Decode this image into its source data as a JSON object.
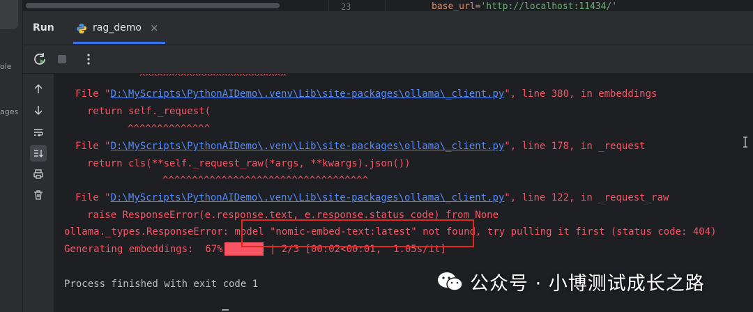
{
  "left_strip": {
    "labels": [
      "ole",
      "ages"
    ]
  },
  "editor_peek": {
    "line_number": "23",
    "code_key": "base_url=",
    "code_value": "'http://localhost:11434/'"
  },
  "header": {
    "title": "Run",
    "tab": {
      "label": "rag_demo",
      "close": "×"
    }
  },
  "toolbar": {
    "icons": [
      "rerun-icon",
      "stop-icon",
      "more-icon"
    ]
  },
  "side_actions": [
    "up-arrow-icon",
    "down-arrow-icon",
    "soft-wrap-icon",
    "scroll-to-end-icon",
    "print-icon",
    "trash-icon"
  ],
  "console": {
    "lines": [
      {
        "kind": "caret",
        "text": "^^^^^^^^^^^^^^^^^^^^^^^^^"
      },
      {
        "kind": "file",
        "prefix": "File \"",
        "path": "D:\\MyScripts\\PythonAIDemo\\.venv\\Lib\\site-packages\\ollama\\_client.py",
        "suffix": "\", line 380, in embeddings"
      },
      {
        "kind": "code",
        "text": "return self._request("
      },
      {
        "kind": "caret",
        "text": "^^^^^^^^^^^^^^"
      },
      {
        "kind": "file",
        "prefix": "File \"",
        "path": "D:\\MyScripts\\PythonAIDemo\\.venv\\Lib\\site-packages\\ollama\\_client.py",
        "suffix": "\", line 178, in _request"
      },
      {
        "kind": "code",
        "text": "return cls(**self._request_raw(*args, **kwargs).json())"
      },
      {
        "kind": "caret",
        "text": "^^^^^^^^^^^^^^^^^^^^^^^^^^^^^^^^^^^"
      },
      {
        "kind": "file",
        "prefix": "File \"",
        "path": "D:\\MyScripts\\PythonAIDemo\\.venv\\Lib\\site-packages\\ollama\\_client.py",
        "suffix": "\", line 122, in _request_raw"
      },
      {
        "kind": "code",
        "text": "raise ResponseError(e.response.text, e.response.status_code) from None"
      },
      {
        "kind": "error",
        "text": "ollama._types.ResponseError: model \"nomic-embed-text:latest\" not found, try pulling it first (status code: 404)"
      },
      {
        "kind": "progress",
        "text": "Generating embeddings:  67%|       | 2/3 [00:02<00:01,  1.05s/it]"
      },
      {
        "kind": "exit",
        "text": "Process finished with exit code 1"
      }
    ],
    "progress_percent": 67
  },
  "watermark": {
    "text": "公众号 · 小博测试成长之路"
  },
  "colors": {
    "error": "#f75464",
    "link": "#548af7",
    "highlight": "#e0281e",
    "accent": "#3574f0"
  }
}
